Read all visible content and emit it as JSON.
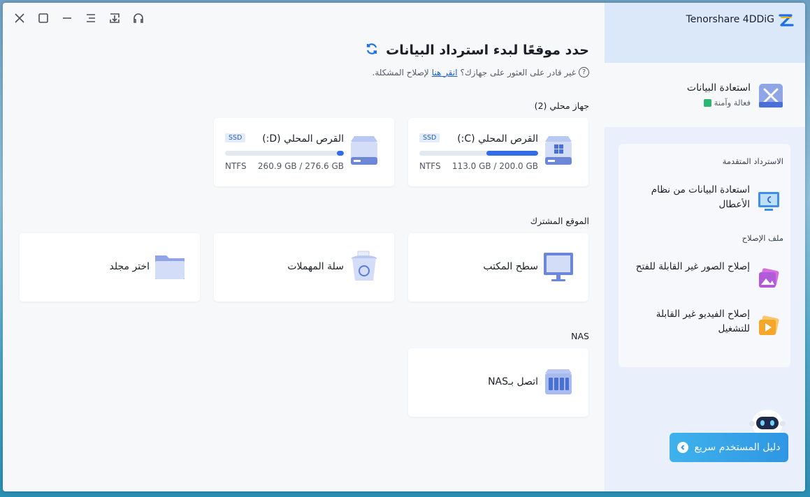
{
  "titlebar": {
    "icons": [
      "close-icon",
      "maximize-icon",
      "minimize-icon",
      "menu-icon",
      "download-icon",
      "headset-icon"
    ]
  },
  "heading": {
    "title": "حدد موقعًا لبدء استرداد البيانات"
  },
  "help": {
    "prefix": "غير قادر على العثور على جهازك؟",
    "link": "انقر هنا",
    "suffix": "لإصلاح المشكلة."
  },
  "sections": {
    "local": "جهاز محلي (2)",
    "common": "الموقع المشترك",
    "nas": "NAS"
  },
  "drives": [
    {
      "name": "القرص المحلي (C:)",
      "badge": "SSD",
      "fs": "NTFS",
      "size": "113.0 GB / 200.0 GB",
      "used_percent": 43.5,
      "icon": "windows-drive-icon"
    },
    {
      "name": "القرص المحلي (D:)",
      "badge": "SSD",
      "fs": "NTFS",
      "size": "260.9 GB / 276.6 GB",
      "used_percent": 5.7,
      "icon": "drive-icon"
    }
  ],
  "common_locations": [
    {
      "name": "سطح المكتب",
      "icon": "desktop-icon"
    },
    {
      "name": "سلة المهملات",
      "icon": "recycle-bin-icon"
    },
    {
      "name": "اختر مجلد",
      "icon": "folder-icon"
    }
  ],
  "nas_location": {
    "name": "اتصل بـNAS",
    "icon": "nas-icon"
  },
  "sidebar": {
    "brand": "Tenorshare 4DDiG",
    "active_item": {
      "title": "استعادة البيانات",
      "subtitle": "فعالة وآمنة"
    },
    "advanced_group": "الاسترداد المتقدمة",
    "advanced_items": [
      {
        "label": "استعادة البيانات من نظام الأعطال"
      }
    ],
    "repair_group": "ملف الإصلاح",
    "repair_items": [
      {
        "label": "إصلاح الصور غير القابلة للفتح"
      },
      {
        "label": "إصلاح الفيديو غير القابلة للتشغيل"
      }
    ],
    "guide": "دليل المستخدم سريع"
  },
  "colors": {
    "accent": "#2f6ee6",
    "guide_button": "#3fb2ec",
    "sidebar_bg": "#e9f0fb"
  }
}
